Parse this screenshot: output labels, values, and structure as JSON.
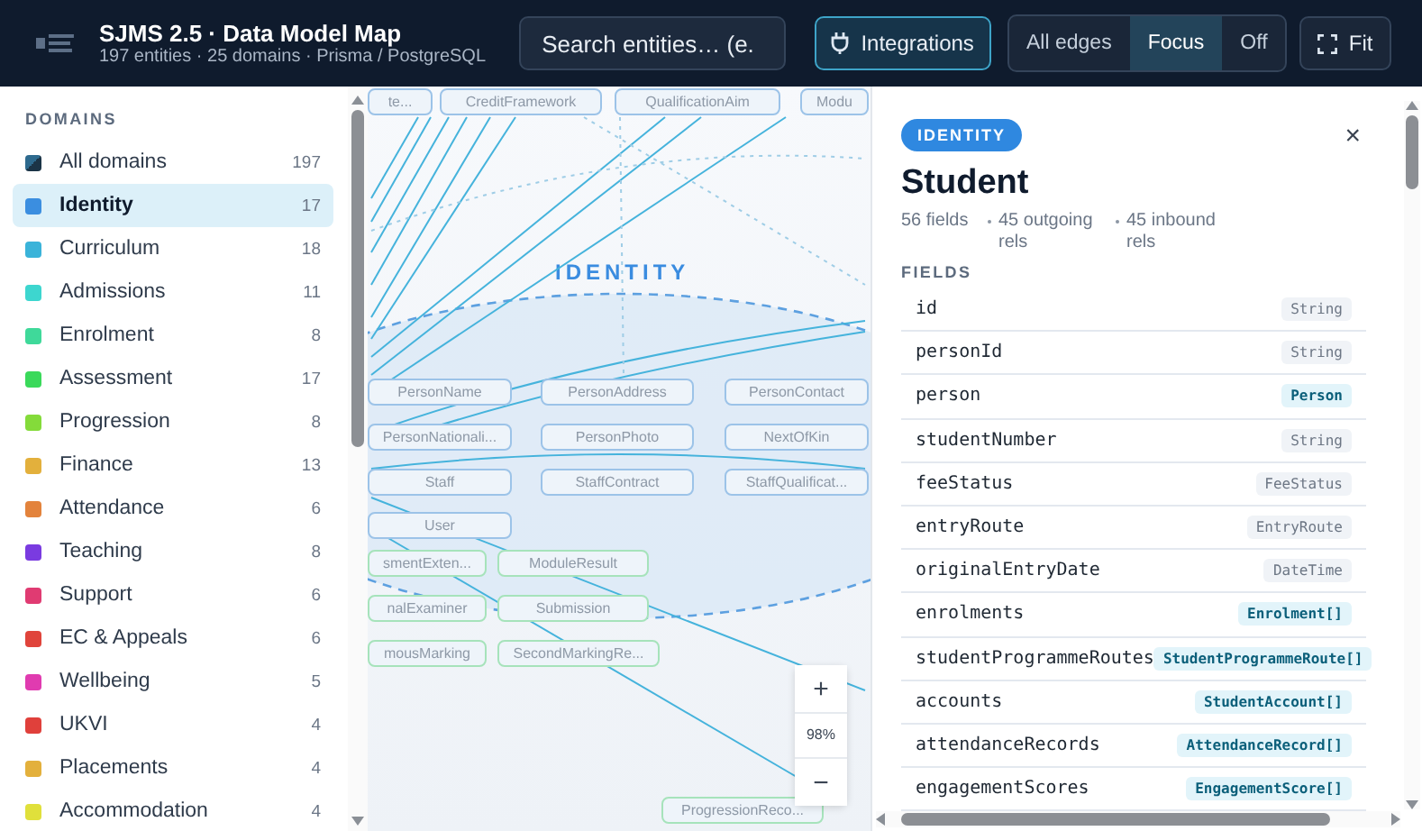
{
  "header": {
    "title": "SJMS 2.5 · Data Model Map",
    "subtitle": "197 entities · 25 domains · Prisma / PostgreSQL",
    "search": {
      "placeholder": "Search entities… (e."
    },
    "integrations": {
      "label": "Integrations",
      "active": true
    },
    "edge_modes": [
      {
        "label": "All edges",
        "selected": false
      },
      {
        "label": "Focus",
        "selected": true
      },
      {
        "label": "Off",
        "selected": false
      }
    ],
    "fit": {
      "label": "Fit"
    }
  },
  "sidebar": {
    "heading": "DOMAINS",
    "items": [
      {
        "kind": "all",
        "label": "All domains",
        "count": "197",
        "color": "#2e6a8e",
        "selected": false
      },
      {
        "kind": "domain",
        "label": "Identity",
        "count": "17",
        "color": "#3b8ee0",
        "selected": true
      },
      {
        "kind": "domain",
        "label": "Curriculum",
        "count": "18",
        "color": "#3ab3d9",
        "selected": false
      },
      {
        "kind": "domain",
        "label": "Admissions",
        "count": "11",
        "color": "#3dd6cf",
        "selected": false
      },
      {
        "kind": "domain",
        "label": "Enrolment",
        "count": "8",
        "color": "#3fd99a",
        "selected": false
      },
      {
        "kind": "domain",
        "label": "Assessment",
        "count": "17",
        "color": "#3ad95a",
        "selected": false
      },
      {
        "kind": "domain",
        "label": "Progression",
        "count": "8",
        "color": "#84db3a",
        "selected": false
      },
      {
        "kind": "domain",
        "label": "Finance",
        "count": "13",
        "color": "#e3b03c",
        "selected": false
      },
      {
        "kind": "domain",
        "label": "Attendance",
        "count": "6",
        "color": "#e3833c",
        "selected": false
      },
      {
        "kind": "domain",
        "label": "Teaching",
        "count": "8",
        "color": "#7a3be0",
        "selected": false
      },
      {
        "kind": "domain",
        "label": "Support",
        "count": "6",
        "color": "#e03b72",
        "selected": false
      },
      {
        "kind": "domain",
        "label": "EC & Appeals",
        "count": "6",
        "color": "#e0443b",
        "selected": false
      },
      {
        "kind": "domain",
        "label": "Wellbeing",
        "count": "5",
        "color": "#e03bb0",
        "selected": false
      },
      {
        "kind": "domain",
        "label": "UKVI",
        "count": "4",
        "color": "#e0403b",
        "selected": false
      },
      {
        "kind": "domain",
        "label": "Placements",
        "count": "4",
        "color": "#e3b03c",
        "selected": false
      },
      {
        "kind": "domain",
        "label": "Accommodation",
        "count": "4",
        "color": "#e0e03b",
        "selected": false
      }
    ]
  },
  "canvas": {
    "domain_label": "IDENTITY",
    "nodes": [
      {
        "label": "te...",
        "color": "#9cc3e8"
      },
      {
        "label": "CreditFramework",
        "color": "#9cc3e8"
      },
      {
        "label": "QualificationAim",
        "color": "#9cc3e8"
      },
      {
        "label": "Modu",
        "color": "#9cc3e8"
      },
      {
        "label": "PersonName",
        "color": "#9cc3e8"
      },
      {
        "label": "PersonAddress",
        "color": "#9cc3e8"
      },
      {
        "label": "PersonContact",
        "color": "#9cc3e8"
      },
      {
        "label": "PersonNationali...",
        "color": "#9cc3e8"
      },
      {
        "label": "PersonPhoto",
        "color": "#9cc3e8"
      },
      {
        "label": "NextOfKin",
        "color": "#9cc3e8"
      },
      {
        "label": "Staff",
        "color": "#9cc3e8"
      },
      {
        "label": "StaffContract",
        "color": "#9cc3e8"
      },
      {
        "label": "StaffQualificat...",
        "color": "#9cc3e8"
      },
      {
        "label": "User",
        "color": "#9cc3e8"
      },
      {
        "label": "smentExten...",
        "color": "#a6e3bb"
      },
      {
        "label": "ModuleResult",
        "color": "#a6e3bb"
      },
      {
        "label": "nalExaminer",
        "color": "#a6e3bb"
      },
      {
        "label": "Submission",
        "color": "#a6e3bb"
      },
      {
        "label": "mousMarking",
        "color": "#a6e3bb"
      },
      {
        "label": "SecondMarkingRe...",
        "color": "#a6e3bb"
      },
      {
        "label": "ProgressionReco...",
        "color": "#a6e3bb"
      }
    ],
    "zoom": {
      "zoom_in": "+",
      "level_text": "98%",
      "zoom_out": "−"
    }
  },
  "panel": {
    "badge": "IDENTITY",
    "close": "×",
    "title": "Student",
    "stats": [
      "56 fields",
      "45 outgoing rels",
      "45 inbound rels"
    ],
    "fields_heading": "FIELDS",
    "fields": [
      {
        "name": "id",
        "type": "String",
        "kind": "scalar"
      },
      {
        "name": "personId",
        "type": "String",
        "kind": "scalar"
      },
      {
        "name": "person",
        "type": "Person",
        "kind": "relation"
      },
      {
        "name": "studentNumber",
        "type": "String",
        "kind": "scalar"
      },
      {
        "name": "feeStatus",
        "type": "FeeStatus",
        "kind": "scalar"
      },
      {
        "name": "entryRoute",
        "type": "EntryRoute",
        "kind": "scalar"
      },
      {
        "name": "originalEntryDate",
        "type": "DateTime",
        "kind": "scalar"
      },
      {
        "name": "enrolments",
        "type": "Enrolment[]",
        "kind": "relation"
      },
      {
        "name": "studentProgrammeRoutes",
        "type": "StudentProgrammeRoute[]",
        "kind": "relation"
      },
      {
        "name": "accounts",
        "type": "StudentAccount[]",
        "kind": "relation"
      },
      {
        "name": "attendanceRecords",
        "type": "AttendanceRecord[]",
        "kind": "relation"
      },
      {
        "name": "engagementScores",
        "type": "EngagementScore[]",
        "kind": "relation"
      }
    ]
  }
}
